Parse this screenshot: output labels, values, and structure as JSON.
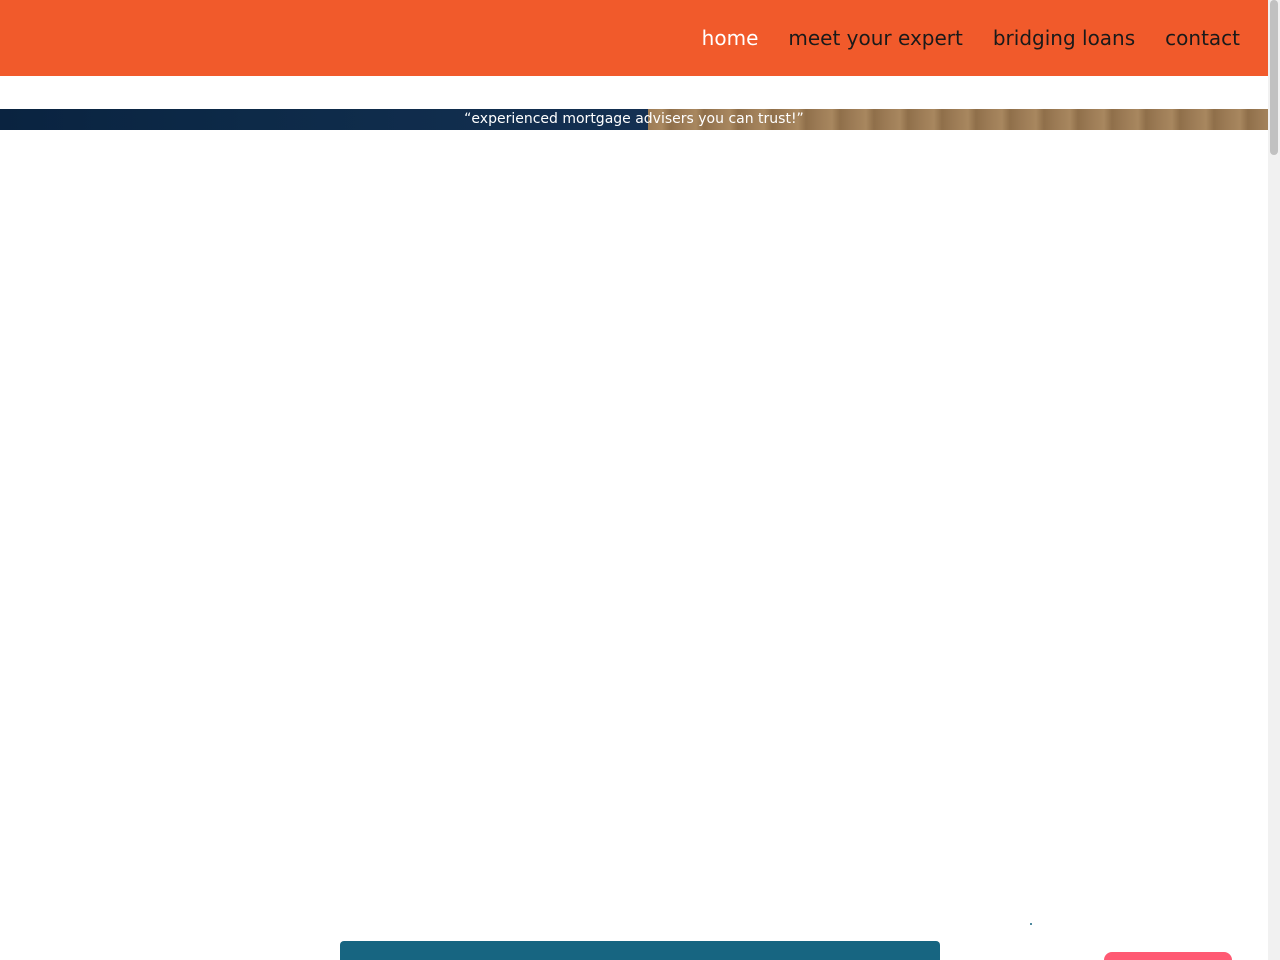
{
  "colors": {
    "header_bg": "#f15a2b",
    "nav_active": "#ffffff",
    "nav_default": "#1a1a1a",
    "hero_dark": "#0a2340",
    "hero_wood": "#9c7b55",
    "content_box": "#176581",
    "dot": "#176581",
    "pill": "#ff5a73"
  },
  "nav": {
    "items": [
      {
        "label": "home",
        "active": true
      },
      {
        "label": "meet your expert",
        "active": false
      },
      {
        "label": "bridging loans",
        "active": false
      },
      {
        "label": "contact",
        "active": false
      }
    ]
  },
  "hero": {
    "tagline": "“experienced mortgage advisers you can trust!”"
  }
}
